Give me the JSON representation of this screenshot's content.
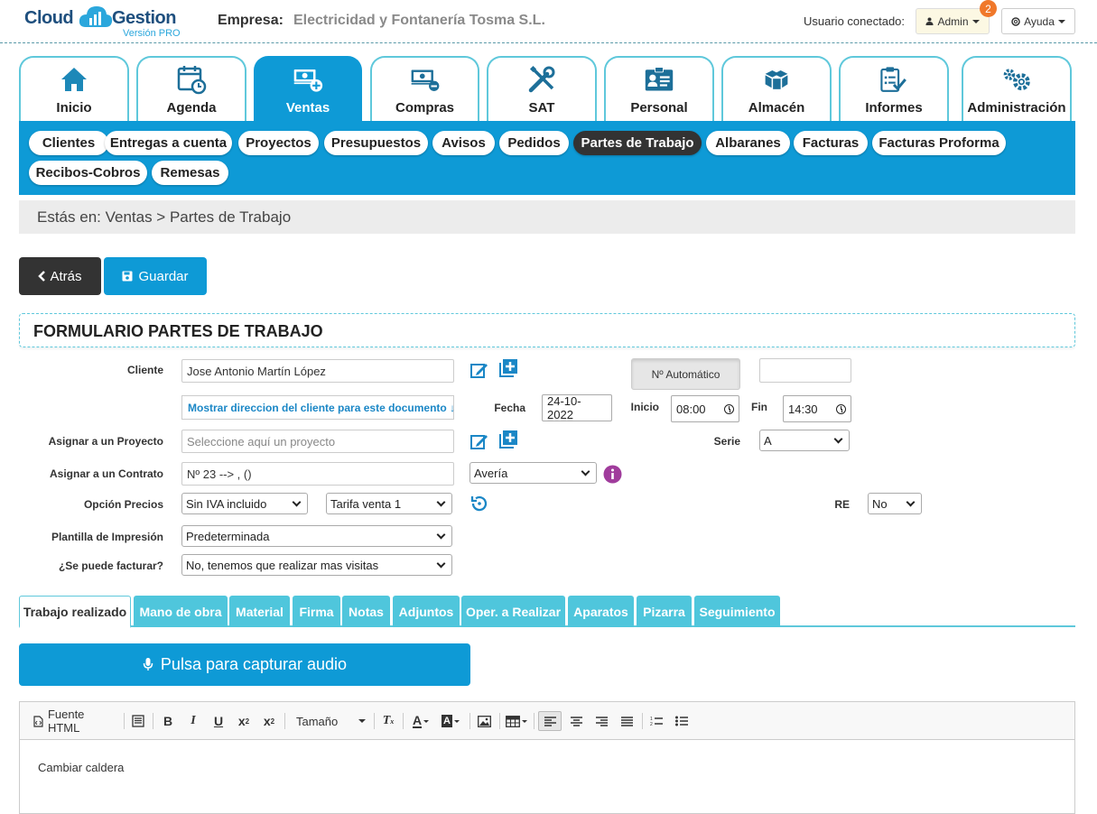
{
  "brand": {
    "cloud": "Cloud",
    "gestion": "Gestion",
    "version": "Versión PRO"
  },
  "header": {
    "empresa_label": "Empresa:",
    "empresa_name": "Electricidad y Fontanería Tosma S.L.",
    "user_label": "Usuario conectado:",
    "admin_label": "Admin",
    "notifications": "2",
    "help_label": "Ayuda"
  },
  "modules": [
    {
      "label": "Inicio",
      "icon": "home-icon"
    },
    {
      "label": "Agenda",
      "icon": "calendar-icon"
    },
    {
      "label": "Ventas",
      "icon": "cash-plus-icon",
      "active": true
    },
    {
      "label": "Compras",
      "icon": "cash-minus-icon"
    },
    {
      "label": "SAT",
      "icon": "tools-icon"
    },
    {
      "label": "Personal",
      "icon": "id-card-icon"
    },
    {
      "label": "Almacén",
      "icon": "boxes-icon"
    },
    {
      "label": "Informes",
      "icon": "clipboard-check-icon"
    },
    {
      "label": "Administración",
      "icon": "gears-icon"
    }
  ],
  "subnav": [
    "Clientes",
    "Entregas a cuenta",
    "Proyectos",
    "Presupuestos",
    "Avisos",
    "Pedidos",
    "Partes de Trabajo",
    "Albaranes",
    "Facturas",
    "Facturas Proforma",
    "Recibos-Cobros",
    "Remesas"
  ],
  "breadcrumb": "Estás en: Ventas > Partes de Trabajo",
  "actions": {
    "back": "Atrás",
    "save": "Guardar"
  },
  "form": {
    "title": "FORMULARIO PARTES DE TRABAJO",
    "cliente_label": "Cliente",
    "cliente_value": "Jose Antonio Martín López",
    "auto_number": "Nº Automático",
    "number_value": "",
    "show_address": "Mostrar direccion del cliente para este documento",
    "fecha_label": "Fecha",
    "fecha_value": "24-10-2022",
    "inicio_label": "Inicio",
    "inicio_value": "08:00",
    "fin_label": "Fin",
    "fin_value": "14:30",
    "proyecto_label": "Asignar a un Proyecto",
    "proyecto_placeholder": "Seleccione aquí un proyecto",
    "serie_label": "Serie",
    "serie_value": "A",
    "contrato_label": "Asignar a un Contrato",
    "contrato_value": "Nº 23 --> ,  ()",
    "tipo_value": "Avería",
    "precios_label": "Opción Precios",
    "iva_value": "Sin IVA incluido",
    "tarifa_value": "Tarifa venta 1",
    "re_label": "RE",
    "re_value": "No",
    "plantilla_label": "Plantilla de Impresión",
    "plantilla_value": "Predeterminada",
    "facturar_label": "¿Se puede facturar?",
    "facturar_value": "No, tenemos que realizar mas visitas"
  },
  "tabs": [
    "Trabajo realizado",
    "Mano de obra",
    "Material",
    "Firma",
    "Notas",
    "Adjuntos",
    "Oper. a Realizar",
    "Aparatos",
    "Pizarra",
    "Seguimiento"
  ],
  "audio_button": "Pulsa para capturar audio",
  "editor": {
    "source_label": "Fuente HTML",
    "size_label": "Tamaño",
    "content": "Cambiar caldera"
  },
  "colors": {
    "primary": "#0e9ad6",
    "tab": "#4fc6dc",
    "dark": "#333333",
    "info": "#a03c9c"
  }
}
